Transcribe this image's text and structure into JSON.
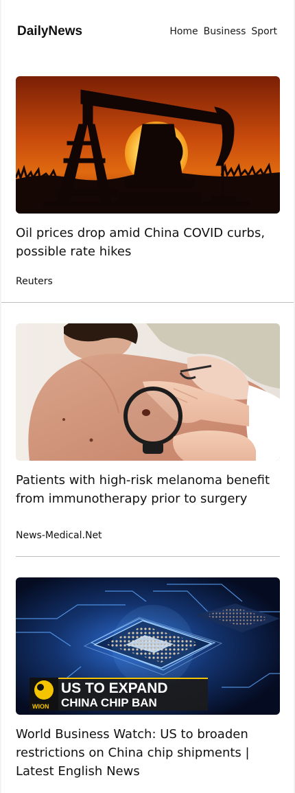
{
  "header": {
    "brand": "DailyNews",
    "nav": [
      "Home",
      "Business",
      "Sport"
    ]
  },
  "articles": [
    {
      "title": "Oil prices drop amid China COVID curbs, possible rate hikes",
      "source": "Reuters",
      "image": "oil-pumpjack-sunset"
    },
    {
      "title": "Patients with high-risk melanoma benefit from immunotherapy prior to surgery",
      "source": "News-Medical.Net",
      "image": "doctor-skin-exam"
    },
    {
      "title": "World Business Watch: US to broaden restrictions on China chip shipments | Latest English News",
      "image": "circuit-chip",
      "image_overlay": {
        "logo": "WION",
        "line1": "US TO EXPAND",
        "line2": "CHINA CHIP BAN"
      }
    }
  ],
  "colors": {
    "background": "#ffffff",
    "outer_background": "#f2f2f2",
    "divider": "#bdbdbd",
    "text": "#111111",
    "wion_yellow": "#f5c400"
  }
}
